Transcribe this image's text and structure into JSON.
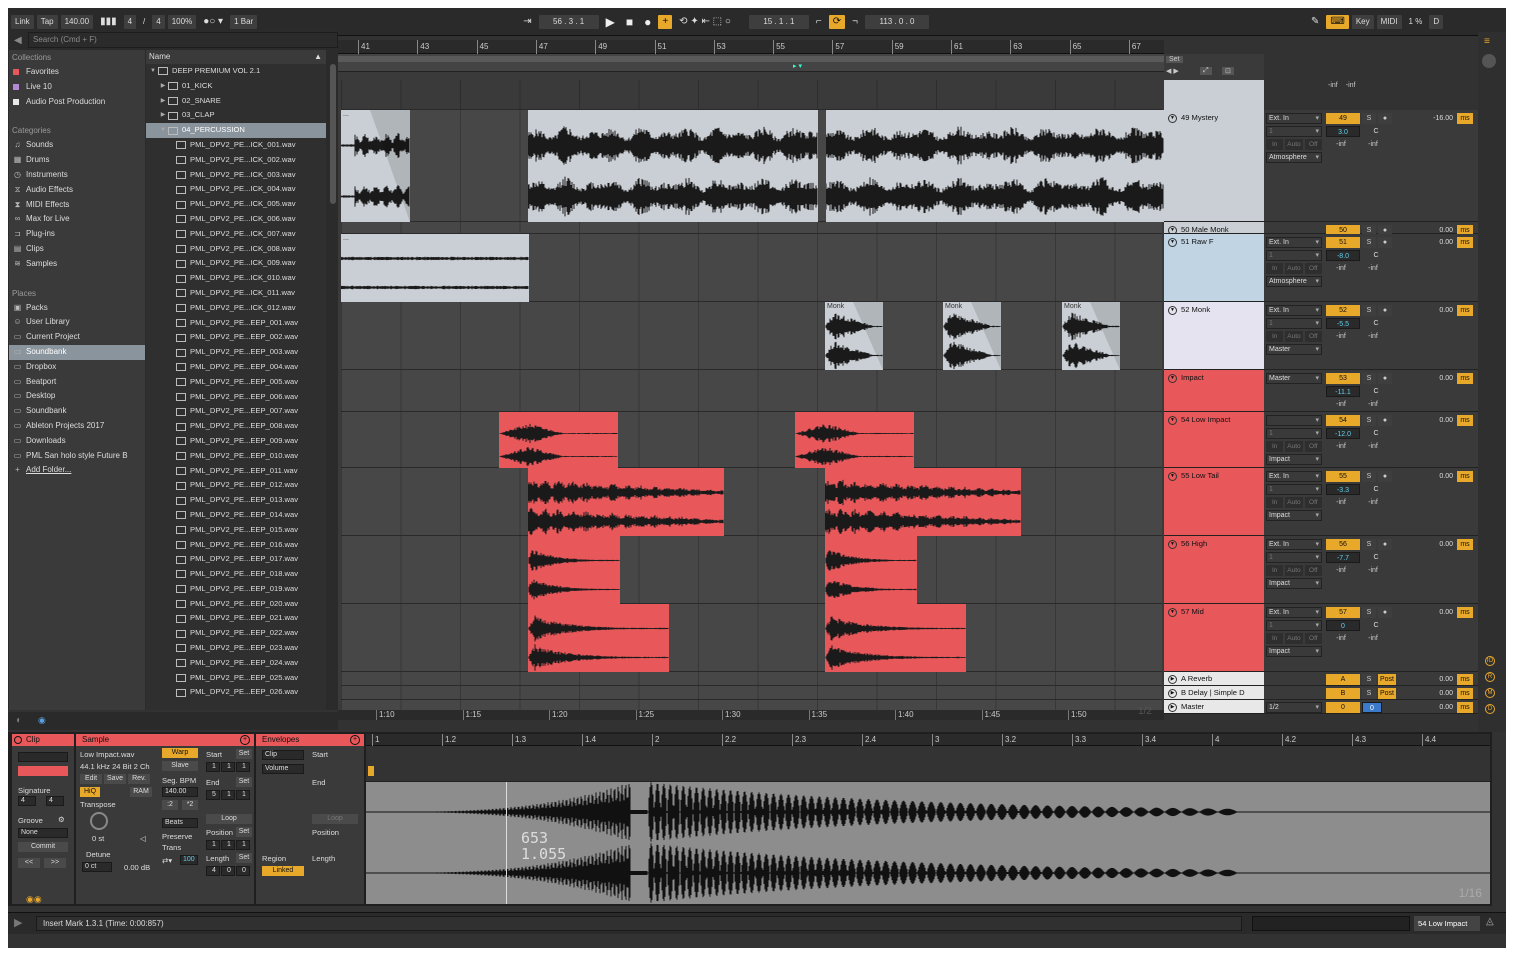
{
  "transport": {
    "link": "Link",
    "tap": "Tap",
    "tempo": "140.00",
    "sig_num": "4",
    "sig_sep": "/",
    "sig_den": "4",
    "zoom": "100%",
    "quant": "1 Bar",
    "position": "56 .  3 .  1",
    "loop_start": "15 .  1 .  1",
    "loop_len": "113 .  0 .  0",
    "key": "Key",
    "midi": "MIDI",
    "cpu": "1 %",
    "d": "D"
  },
  "browser": {
    "search_placeholder": "Search (Cmd + F)",
    "collections_title": "Collections",
    "collections": [
      {
        "label": "Favorites",
        "color": "#e8575a"
      },
      {
        "label": "Live 10",
        "color": "#b48ad6"
      },
      {
        "label": "Audio Post Production",
        "color": "#e8e8e8"
      }
    ],
    "categories_title": "Categories",
    "categories": [
      {
        "label": "Sounds",
        "icon": "music-note-icon"
      },
      {
        "label": "Drums",
        "icon": "grid-icon"
      },
      {
        "label": "Instruments",
        "icon": "clock-icon"
      },
      {
        "label": "Audio Effects",
        "icon": "audio-fx-icon"
      },
      {
        "label": "MIDI Effects",
        "icon": "midi-fx-icon"
      },
      {
        "label": "Max for Live",
        "icon": "max-icon"
      },
      {
        "label": "Plug-ins",
        "icon": "plug-icon"
      },
      {
        "label": "Clips",
        "icon": "clip-icon"
      },
      {
        "label": "Samples",
        "icon": "sample-icon"
      }
    ],
    "places_title": "Places",
    "places": [
      {
        "label": "Packs",
        "icon": "box-icon"
      },
      {
        "label": "User Library",
        "icon": "user-icon"
      },
      {
        "label": "Current Project",
        "icon": "folder-icon"
      },
      {
        "label": "Soundbank",
        "icon": "folder-icon",
        "selected": true
      },
      {
        "label": "Dropbox",
        "icon": "folder-icon"
      },
      {
        "label": "Beatport",
        "icon": "folder-icon"
      },
      {
        "label": "Desktop",
        "icon": "folder-icon"
      },
      {
        "label": "Soundbank",
        "icon": "folder-icon"
      },
      {
        "label": "Ableton Projects 2017",
        "icon": "folder-icon"
      },
      {
        "label": "Downloads",
        "icon": "folder-icon"
      },
      {
        "label": "PML San holo style Future B",
        "icon": "folder-icon"
      },
      {
        "label": "Add Folder...",
        "icon": "add-icon"
      }
    ],
    "name_header": "Name",
    "tree": [
      {
        "label": "DEEP PREMIUM VOL 2.1",
        "level": 0,
        "type": "folder",
        "open": true
      },
      {
        "label": "01_KICK",
        "level": 1,
        "type": "folder"
      },
      {
        "label": "02_SNARE",
        "level": 1,
        "type": "folder"
      },
      {
        "label": "03_CLAP",
        "level": 1,
        "type": "folder"
      },
      {
        "label": "04_PERCUSSION",
        "level": 1,
        "type": "folder",
        "open": true,
        "selected": true
      }
    ],
    "files": [
      "PML_DPV2_PE...ICK_001.wav",
      "PML_DPV2_PE...ICK_002.wav",
      "PML_DPV2_PE...ICK_003.wav",
      "PML_DPV2_PE...ICK_004.wav",
      "PML_DPV2_PE...ICK_005.wav",
      "PML_DPV2_PE...ICK_006.wav",
      "PML_DPV2_PE...ICK_007.wav",
      "PML_DPV2_PE...ICK_008.wav",
      "PML_DPV2_PE...ICK_009.wav",
      "PML_DPV2_PE...ICK_010.wav",
      "PML_DPV2_PE...ICK_011.wav",
      "PML_DPV2_PE...ICK_012.wav",
      "PML_DPV2_PE...EEP_001.wav",
      "PML_DPV2_PE...EEP_002.wav",
      "PML_DPV2_PE...EEP_003.wav",
      "PML_DPV2_PE...EEP_004.wav",
      "PML_DPV2_PE...EEP_005.wav",
      "PML_DPV2_PE...EEP_006.wav",
      "PML_DPV2_PE...EEP_007.wav",
      "PML_DPV2_PE...EEP_008.wav",
      "PML_DPV2_PE...EEP_009.wav",
      "PML_DPV2_PE...EEP_010.wav",
      "PML_DPV2_PE...EEP_011.wav",
      "PML_DPV2_PE...EEP_012.wav",
      "PML_DPV2_PE...EEP_013.wav",
      "PML_DPV2_PE...EEP_014.wav",
      "PML_DPV2_PE...EEP_015.wav",
      "PML_DPV2_PE...EEP_016.wav",
      "PML_DPV2_PE...EEP_017.wav",
      "PML_DPV2_PE...EEP_018.wav",
      "PML_DPV2_PE...EEP_019.wav",
      "PML_DPV2_PE...EEP_020.wav",
      "PML_DPV2_PE...EEP_021.wav",
      "PML_DPV2_PE...EEP_022.wav",
      "PML_DPV2_PE...EEP_023.wav",
      "PML_DPV2_PE...EEP_024.wav",
      "PML_DPV2_PE...EEP_025.wav",
      "PML_DPV2_PE...EEP_026.wav"
    ]
  },
  "arrangement": {
    "bars": [
      "41",
      "43",
      "45",
      "47",
      "49",
      "51",
      "53",
      "55",
      "57",
      "59",
      "61",
      "63",
      "65",
      "67"
    ],
    "times": [
      "1:10",
      "1:15",
      "1:20",
      "1:25",
      "1:30",
      "1:35",
      "1:40",
      "1:45",
      "1:50"
    ],
    "page": "1/2",
    "set_label": "Set",
    "clip_labels": {
      "monk": "Monk",
      "dots": "..."
    }
  },
  "tracks": [
    {
      "name": "49 Mystery",
      "color": "#c9cfd4",
      "input": "Ext. In",
      "ch": "1",
      "out": "Atmosphere",
      "num": "49",
      "vol": "3.0",
      "pan": "C",
      "inf1": "-inf",
      "inf2": "-inf",
      "delay": "-16.00"
    },
    {
      "name": "50 Male Monk",
      "color": "#c9cfd4",
      "num": "50",
      "delay": "0.00"
    },
    {
      "name": "51 Raw F",
      "color": "#c0d4e4",
      "input": "Ext. In",
      "ch": "1",
      "out": "Atmosphere",
      "num": "51",
      "vol": "-8.0",
      "pan": "C",
      "inf1": "-inf",
      "inf2": "-inf",
      "delay": "0.00"
    },
    {
      "name": "52 Monk",
      "color": "#e5e3ef",
      "input": "Ext. In",
      "ch": "1",
      "out": "Master",
      "num": "52",
      "vol": "-5.5",
      "pan": "C",
      "inf1": "-inf",
      "inf2": "-inf",
      "delay": "0.00"
    },
    {
      "name": "Impact",
      "color": "#e8575a",
      "input": "Master",
      "num": "53",
      "vol": "-11.1",
      "pan": "C",
      "inf1": "-inf",
      "inf2": "-inf",
      "delay": "0.00"
    },
    {
      "name": "54 Low Impact",
      "color": "#e8575a",
      "ch": "1",
      "out": "Impact",
      "num": "54",
      "vol": "-12.0",
      "pan": "C",
      "inf1": "-inf",
      "inf2": "-inf",
      "delay": "0.00"
    },
    {
      "name": "55 Low Tail",
      "color": "#e8575a",
      "input": "Ext. In",
      "ch": "1",
      "out": "Impact",
      "num": "55",
      "vol": "-3.3",
      "pan": "C",
      "inf1": "-inf",
      "inf2": "-inf",
      "delay": "0.00"
    },
    {
      "name": "56 High",
      "color": "#e8575a",
      "input": "Ext. In",
      "ch": "1",
      "out": "Impact",
      "num": "56",
      "vol": "-7.7",
      "pan": "C",
      "inf1": "-inf",
      "inf2": "-inf",
      "delay": "0.00"
    },
    {
      "name": "57 Mid",
      "color": "#e8575a",
      "input": "Ext. In",
      "ch": "1",
      "out": "Impact",
      "num": "57",
      "vol": "0",
      "pan": "C",
      "inf1": "-inf",
      "inf2": "-inf",
      "delay": "0.00"
    }
  ],
  "returns": [
    {
      "name": "A Reverb",
      "num": "A",
      "post": "Post",
      "delay": "0.00"
    },
    {
      "name": "B Delay | Simple D",
      "num": "B",
      "post": "Post",
      "delay": "0.00"
    },
    {
      "name": "Master",
      "num": "0",
      "vol": "0",
      "out": "1/2",
      "delay": "0.00"
    }
  ],
  "master_top": {
    "inf1": "-inf",
    "inf2": "-inf"
  },
  "io_labels": {
    "in": "In",
    "auto": "Auto",
    "off": "Off",
    "s": "S",
    "ms": "ms"
  },
  "clip_panel": {
    "title": "Clip",
    "signature_label": "Signature",
    "sig_num": "4",
    "sig_den": "4",
    "groove_label": "Groove",
    "groove": "None",
    "commit": "Commit",
    "nav_left": "<<",
    "nav_right": ">>"
  },
  "sample_panel": {
    "title": "Sample",
    "file": "Low Impact.wav",
    "info": "44.1 kHz 24 Bit 2 Ch",
    "edit": "Edit",
    "save": "Save",
    "rev": "Rev.",
    "hiq": "HiQ",
    "ram": "RAM",
    "transpose_label": "Transpose",
    "transpose": "0 st",
    "detune_label": "Detune",
    "detune": "0 ct",
    "gain": "0.00 dB",
    "warp": "Warp",
    "slave": "Slave",
    "seg_bpm_label": "Seg. BPM",
    "seg_bpm": "140.00",
    "half": ":2",
    "double": "*2",
    "beats": "Beats",
    "preserve": "Preserve",
    "trans": "Trans",
    "grain": "100",
    "start_label": "Start",
    "set": "Set",
    "start": [
      "1",
      "1",
      "1"
    ],
    "end_label": "End",
    "end": [
      "5",
      "1",
      "1"
    ],
    "loop": "Loop",
    "position_label": "Position",
    "position": [
      "1",
      "1",
      "1"
    ],
    "length_label": "Length",
    "length": [
      "4",
      "0",
      "0"
    ]
  },
  "envelopes_panel": {
    "title": "Envelopes",
    "source": "Clip",
    "control": "Volume",
    "start_label": "Start",
    "end_label": "End",
    "loop": "Loop",
    "position_label": "Position",
    "region_label": "Region",
    "linked": "Linked",
    "length_label": "Length"
  },
  "sample_view": {
    "ticks": [
      "1",
      "1.2",
      "1.3",
      "1.4",
      "2",
      "2.2",
      "2.3",
      "2.4",
      "3",
      "3.2",
      "3.3",
      "3.4",
      "4",
      "4.2",
      "4.3",
      "4.4"
    ],
    "readout1": "653",
    "readout2": "1.055",
    "page": "1/16"
  },
  "status": {
    "message": "Insert Mark 1.3.1 (Time: 0:00:857)",
    "selected_track": "54 Low Impact"
  }
}
